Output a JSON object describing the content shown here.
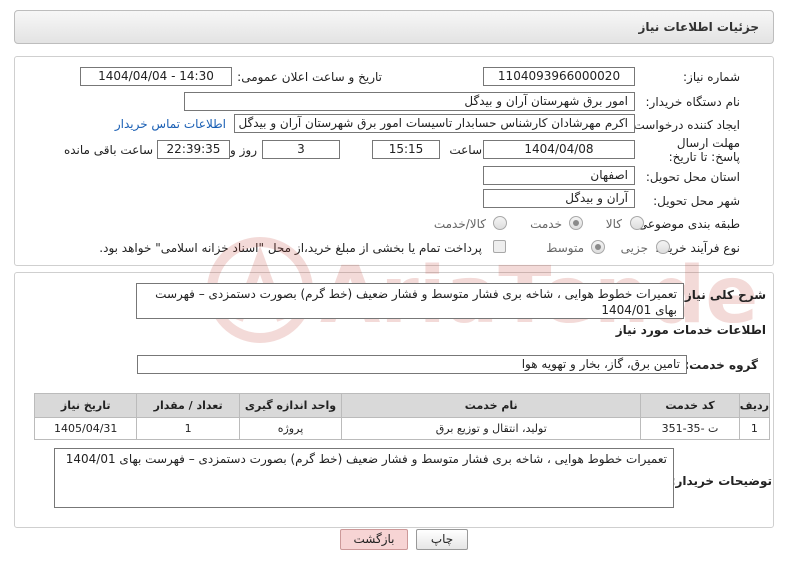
{
  "page": {
    "title": "جزئیات اطلاعات نیاز"
  },
  "fields": {
    "need_number_label": "شماره نیاز:",
    "need_number": "1104093966000020",
    "announce_datetime_label": "تاریخ و ساعت اعلان عمومی:",
    "announce_datetime": "1404/04/04 - 14:30",
    "buyer_org_label": "نام دستگاه خریدار:",
    "buyer_org": "امور برق شهرستان آران و بیدگل",
    "requester_label": "ایجاد کننده درخواست:",
    "requester": "اکرم مهرشادان کارشناس حسابدار تاسیسات امور برق شهرستان آران و بیدگل",
    "buyer_contact_link": "اطلاعات تماس خریدار",
    "deadline_label": "مهلت ارسال پاسخ: تا تاریخ:",
    "deadline_date": "1404/04/08",
    "time_label": "ساعت",
    "deadline_time": "15:15",
    "days_value": "3",
    "days_label": "روز و",
    "remaining_time": "22:39:35",
    "remaining_label": "ساعت باقی مانده",
    "province_label": "استان محل تحویل:",
    "province": "اصفهان",
    "city_label": "شهر محل تحویل:",
    "city": "آران و بیدگل",
    "category_label": "طبقه بندی موضوعی:",
    "category_options": [
      "کالا",
      "خدمت",
      "کالا/خدمت"
    ],
    "process_label": "نوع فرآیند خرید :",
    "process_options": [
      "جزیی",
      "متوسط"
    ],
    "payment_note": "پرداخت تمام یا بخشی از مبلغ خرید،از محل \"اسناد خزانه اسلامی\" خواهد بود."
  },
  "summary": {
    "label": "شرح کلی نیاز:",
    "text": "تعمیرات خطوط هوایی ، شاخه بری فشار متوسط و فشار ضعیف  (خط گرم) بصورت دستمزدی – فهرست بهای 1404/01"
  },
  "services": {
    "section_label": "اطلاعات خدمات مورد نیاز",
    "group_label": "گروه خدمت:",
    "group_value": "تامین برق، گاز، بخار و تهویه هوا",
    "columns": [
      "ردیف",
      "کد خدمت",
      "نام خدمت",
      "واحد اندازه گیری",
      "تعداد / مقدار",
      "تاریخ نیاز"
    ],
    "rows": [
      [
        "1",
        "ت -35-351",
        "تولید، انتقال و توزیع برق",
        "پروژه",
        "1",
        "1405/04/31"
      ]
    ]
  },
  "buyer_notes": {
    "label": "توضیحات خریدار:",
    "text": "تعمیرات خطوط هوایی ، شاخه بری فشار متوسط و فشار ضعیف  (خط گرم) بصورت دستمزدی – فهرست بهای 1404/01"
  },
  "buttons": {
    "print": "چاپ",
    "back": "بازگشت"
  },
  "watermark": {
    "text": "AriaTender.net"
  }
}
